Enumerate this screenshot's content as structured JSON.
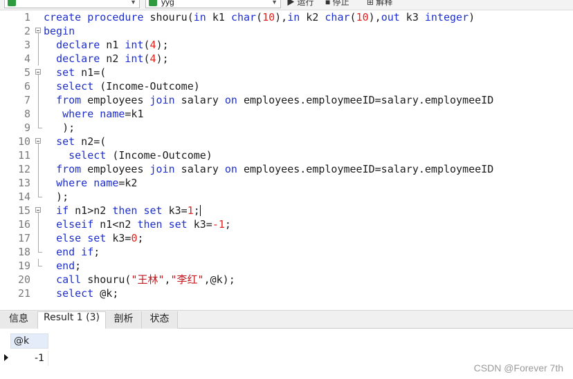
{
  "toolbar": {
    "db1_name": "",
    "db2_name": "yyg",
    "actions": [
      "运行",
      "停止",
      "解释"
    ]
  },
  "editor": {
    "lines": [
      {
        "n": "1",
        "fold": "none",
        "tokens": [
          [
            "kw",
            "create procedure"
          ],
          [
            "t",
            " shouru("
          ],
          [
            "kw",
            "in"
          ],
          [
            "t",
            " k1 "
          ],
          [
            "kw",
            "char"
          ],
          [
            "t",
            "("
          ],
          [
            "num",
            "10"
          ],
          [
            "t",
            "),"
          ],
          [
            "kw",
            "in"
          ],
          [
            "t",
            " k2 "
          ],
          [
            "kw",
            "char"
          ],
          [
            "t",
            "("
          ],
          [
            "num",
            "10"
          ],
          [
            "t",
            "),"
          ],
          [
            "kw",
            "out"
          ],
          [
            "t",
            " k3 "
          ],
          [
            "kw",
            "integer"
          ],
          [
            "t",
            ")"
          ]
        ]
      },
      {
        "n": "2",
        "fold": "open",
        "tokens": [
          [
            "kw",
            "begin"
          ]
        ]
      },
      {
        "n": "3",
        "fold": "line",
        "tokens": [
          [
            "t",
            "  "
          ],
          [
            "kw",
            "declare"
          ],
          [
            "t",
            " n1 "
          ],
          [
            "kw",
            "int"
          ],
          [
            "t",
            "("
          ],
          [
            "num",
            "4"
          ],
          [
            "t",
            ");"
          ]
        ]
      },
      {
        "n": "4",
        "fold": "line",
        "tokens": [
          [
            "t",
            "  "
          ],
          [
            "kw",
            "declare"
          ],
          [
            "t",
            " n2 "
          ],
          [
            "kw",
            "int"
          ],
          [
            "t",
            "("
          ],
          [
            "num",
            "4"
          ],
          [
            "t",
            ");"
          ]
        ]
      },
      {
        "n": "5",
        "fold": "open",
        "tokens": [
          [
            "t",
            "  "
          ],
          [
            "kw",
            "set"
          ],
          [
            "t",
            " n1=("
          ]
        ]
      },
      {
        "n": "6",
        "fold": "line",
        "tokens": [
          [
            "t",
            "  "
          ],
          [
            "kw",
            "select"
          ],
          [
            "t",
            " (Income-Outcome)"
          ]
        ]
      },
      {
        "n": "7",
        "fold": "line",
        "tokens": [
          [
            "t",
            "  "
          ],
          [
            "kw",
            "from"
          ],
          [
            "t",
            " employees "
          ],
          [
            "kw",
            "join"
          ],
          [
            "t",
            " salary "
          ],
          [
            "kw",
            "on"
          ],
          [
            "t",
            " employees.employmeeID=salary.employmeeID"
          ]
        ]
      },
      {
        "n": "8",
        "fold": "line",
        "tokens": [
          [
            "t",
            "   "
          ],
          [
            "kw",
            "where"
          ],
          [
            "t",
            " "
          ],
          [
            "kw",
            "name"
          ],
          [
            "t",
            "=k1"
          ]
        ]
      },
      {
        "n": "9",
        "fold": "end",
        "tokens": [
          [
            "t",
            "   );"
          ]
        ]
      },
      {
        "n": "10",
        "fold": "open",
        "tokens": [
          [
            "t",
            "  "
          ],
          [
            "kw",
            "set"
          ],
          [
            "t",
            " n2=("
          ]
        ]
      },
      {
        "n": "11",
        "fold": "line",
        "tokens": [
          [
            "t",
            "    "
          ],
          [
            "kw",
            "select"
          ],
          [
            "t",
            " (Income-Outcome)"
          ]
        ]
      },
      {
        "n": "12",
        "fold": "line",
        "tokens": [
          [
            "t",
            "  "
          ],
          [
            "kw",
            "from"
          ],
          [
            "t",
            " employees "
          ],
          [
            "kw",
            "join"
          ],
          [
            "t",
            " salary "
          ],
          [
            "kw",
            "on"
          ],
          [
            "t",
            " employees.employmeeID=salary.employmeeID"
          ]
        ]
      },
      {
        "n": "13",
        "fold": "line",
        "tokens": [
          [
            "t",
            "  "
          ],
          [
            "kw",
            "where"
          ],
          [
            "t",
            " "
          ],
          [
            "kw",
            "name"
          ],
          [
            "t",
            "=k2"
          ]
        ]
      },
      {
        "n": "14",
        "fold": "end",
        "tokens": [
          [
            "t",
            "  );"
          ]
        ]
      },
      {
        "n": "15",
        "fold": "open",
        "tokens": [
          [
            "t",
            "  "
          ],
          [
            "kw",
            "if"
          ],
          [
            "t",
            " n1>n2 "
          ],
          [
            "kw",
            "then"
          ],
          [
            "t",
            " "
          ],
          [
            "kw",
            "set"
          ],
          [
            "t",
            " k3="
          ],
          [
            "num",
            "1"
          ],
          [
            "t",
            ";"
          ],
          [
            "caret",
            ""
          ]
        ]
      },
      {
        "n": "16",
        "fold": "line",
        "tokens": [
          [
            "t",
            "  "
          ],
          [
            "kw",
            "elseif"
          ],
          [
            "t",
            " n1<n2 "
          ],
          [
            "kw",
            "then"
          ],
          [
            "t",
            " "
          ],
          [
            "kw",
            "set"
          ],
          [
            "t",
            " k3="
          ],
          [
            "num",
            "-1"
          ],
          [
            "t",
            ";"
          ]
        ]
      },
      {
        "n": "17",
        "fold": "line",
        "tokens": [
          [
            "t",
            "  "
          ],
          [
            "kw",
            "else"
          ],
          [
            "t",
            " "
          ],
          [
            "kw",
            "set"
          ],
          [
            "t",
            " k3="
          ],
          [
            "num",
            "0"
          ],
          [
            "t",
            ";"
          ]
        ]
      },
      {
        "n": "18",
        "fold": "end",
        "tokens": [
          [
            "t",
            "  "
          ],
          [
            "kw",
            "end if"
          ],
          [
            "t",
            ";"
          ]
        ]
      },
      {
        "n": "19",
        "fold": "end",
        "tokens": [
          [
            "t",
            "  "
          ],
          [
            "kw",
            "end"
          ],
          [
            "t",
            ";"
          ]
        ]
      },
      {
        "n": "20",
        "fold": "none",
        "tokens": [
          [
            "t",
            "  "
          ],
          [
            "kw",
            "call"
          ],
          [
            "t",
            " shouru("
          ],
          [
            "str",
            "\"王林\""
          ],
          [
            "t",
            ","
          ],
          [
            "str",
            "\"李红\""
          ],
          [
            "t",
            ",@k);"
          ]
        ]
      },
      {
        "n": "21",
        "fold": "none",
        "tokens": [
          [
            "t",
            "  "
          ],
          [
            "kw",
            "select"
          ],
          [
            "t",
            " @k;"
          ]
        ]
      }
    ]
  },
  "tabs": [
    {
      "label": "信息",
      "active": false
    },
    {
      "label": "Result 1 (3)",
      "active": true
    },
    {
      "label": "剖析",
      "active": false
    },
    {
      "label": "状态",
      "active": false
    }
  ],
  "result": {
    "column": "@k",
    "value": "-1"
  },
  "watermark": "CSDN @Forever 7th"
}
